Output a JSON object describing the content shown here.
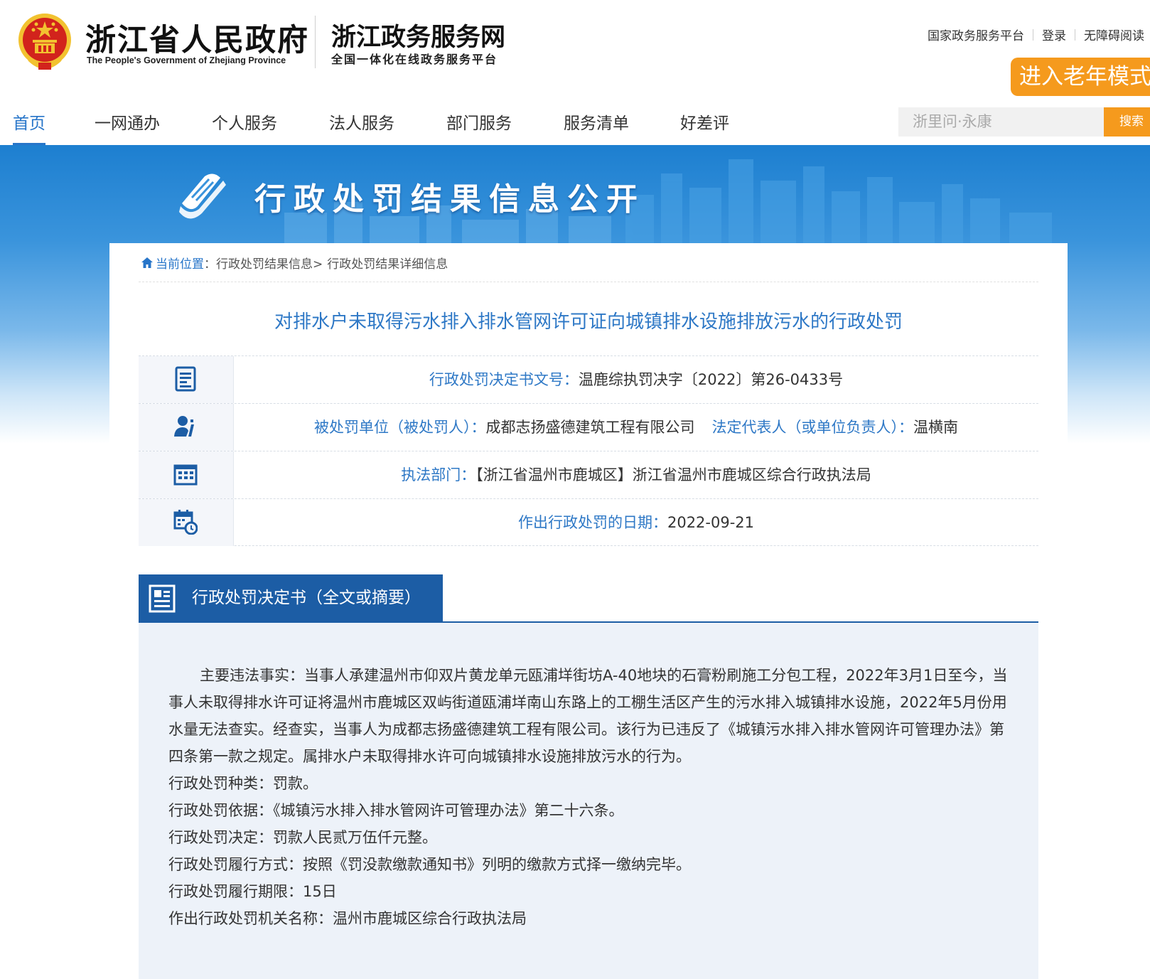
{
  "header": {
    "gov_title": "浙江省人民政府",
    "gov_title_en": "The People's Government of Zhejiang Province",
    "service_title": "浙江政务服务网",
    "service_subtitle": "全国一体化在线政务服务平台",
    "links": [
      "国家政务服务平台",
      "登录",
      "无障碍阅读"
    ],
    "elder_mode_label": "进入老年模式"
  },
  "nav": {
    "items": [
      "首页",
      "一网通办",
      "个人服务",
      "法人服务",
      "部门服务",
      "服务清单",
      "好差评"
    ],
    "active": "首页",
    "search_placeholder": "浙里问·永康",
    "search_button": "搜索"
  },
  "banner": {
    "title": "行政处罚结果信息公开"
  },
  "breadcrumb": {
    "home": "当前位置",
    "sep": "：",
    "level1": "行政处罚结果信息>",
    "level2": "行政处罚结果详细信息"
  },
  "case": {
    "title": "对排水户未取得污水排入排水管网许可证向城镇排水设施排放污水的行政处罚",
    "doc_no_label": "行政处罚决定书文号：",
    "doc_no": "温鹿综执罚决字〔2022〕第26-0433号",
    "party_label": "被处罚单位（被处罚人）：",
    "party": "成都志扬盛德建筑工程有限公司",
    "rep_label": "法定代表人（或单位负责人）：",
    "rep": "温横南",
    "dept_label": "执法部门：",
    "dept": "【浙江省温州市鹿城区】浙江省温州市鹿城区综合行政执法局",
    "date_label": "作出行政处罚的日期：",
    "date": "2022-09-21"
  },
  "decision": {
    "section_title": "行政处罚决定书（全文或摘要）",
    "facts": "主要违法事实：当事人承建温州市仰双片黄龙单元瓯浦垟街坊A-40地块的石膏粉刷施工分包工程，2022年3月1日至今，当事人未取得排水许可证将温州市鹿城区双屿街道瓯浦垟南山东路上的工棚生活区产生的污水排入城镇排水设施，2022年5月份用水量无法查实。经查实，当事人为成都志扬盛德建筑工程有限公司。该行为已违反了《城镇污水排入排水管网许可管理办法》第四条第一款之规定。属排水户未取得排水许可向城镇排水设施排放污水的行为。",
    "type": "行政处罚种类：罚款。",
    "basis": "行政处罚依据：《城镇污水排入排水管网许可管理办法》第二十六条。",
    "result": "行政处罚决定：罚款人民贰万伍仟元整。",
    "method": "行政处罚履行方式：按照《罚没款缴款通知书》列明的缴款方式择一缴纳完毕。",
    "deadline": "行政处罚履行期限：15日",
    "authority": "作出行政处罚机关名称：温州市鹿城区综合行政执法局"
  },
  "colors": {
    "primary_blue": "#2e78c6",
    "section_blue": "#1c5da5",
    "accent_orange": "#f59a1d",
    "emblem_red": "#d2231c",
    "emblem_gold": "#f2c230"
  },
  "icons": [
    "national-emblem-icon",
    "book-icon",
    "home-icon",
    "document-icon",
    "person-icon",
    "building-icon",
    "calendar-clock-icon",
    "section-document-icon"
  ]
}
